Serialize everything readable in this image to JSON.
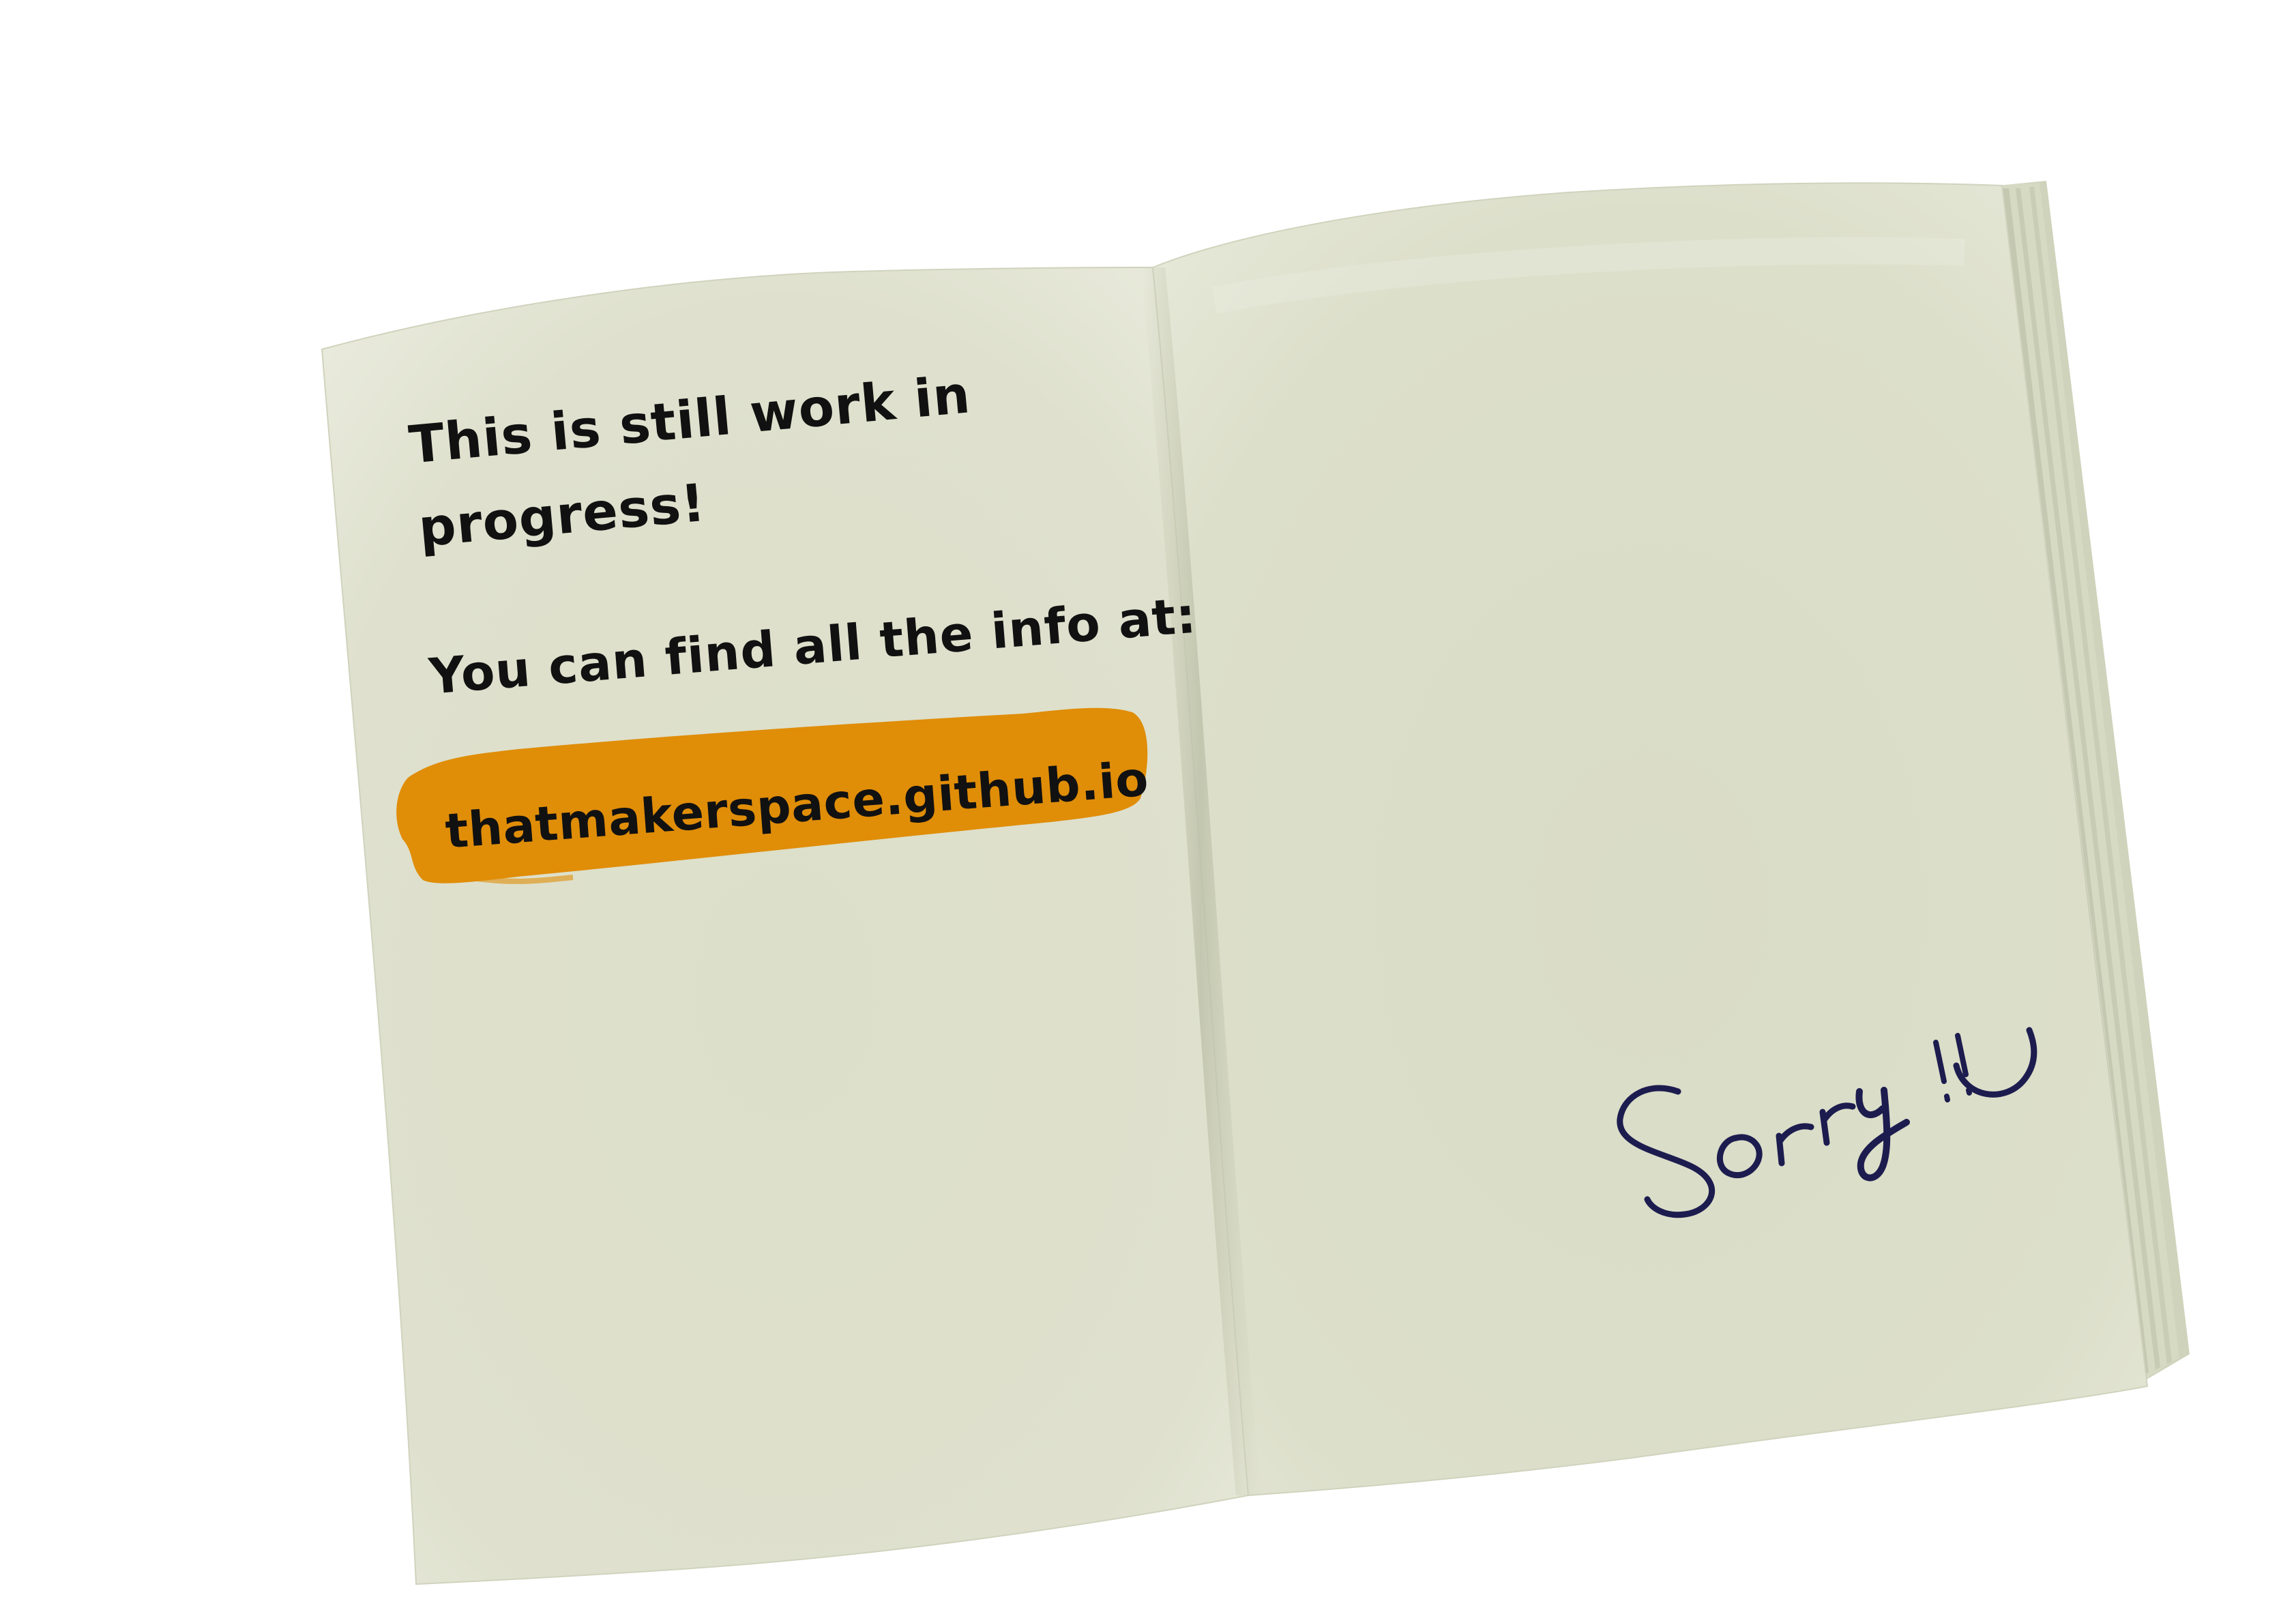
{
  "left_page": {
    "line_1": "This is still work in",
    "line_2": "progress!",
    "line_3": "You can find all the info at:",
    "url": "thatmakerspace.github.io"
  },
  "right_page": {
    "handwritten_note": "Sorry !!"
  },
  "colors": {
    "page": "#dcdfcb",
    "page_edge": "#cfd3bd",
    "highlight": "#e08d08",
    "text": "#111111",
    "ink": "#1d1c4f"
  }
}
